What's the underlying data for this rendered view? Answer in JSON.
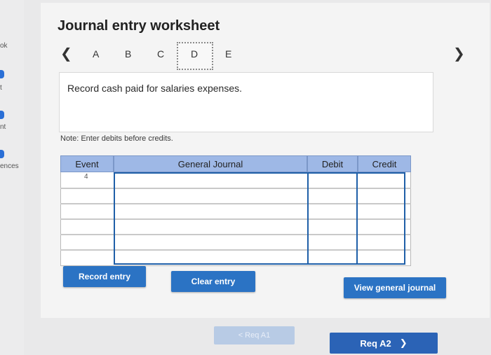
{
  "sidebar": {
    "items": [
      {
        "label": "ok"
      },
      {
        "label": "t"
      },
      {
        "label": "nt"
      },
      {
        "label": "ences"
      }
    ]
  },
  "worksheet": {
    "title": "Journal entry worksheet",
    "tabs": [
      "A",
      "B",
      "C",
      "D",
      "E"
    ],
    "active_tab": "D",
    "instruction": "Record cash paid for salaries expenses.",
    "note": "Note: Enter debits before credits."
  },
  "table": {
    "headers": {
      "event": "Event",
      "general_journal": "General Journal",
      "debit": "Debit",
      "credit": "Credit"
    },
    "rows": [
      {
        "event": "4",
        "account": "",
        "debit": "",
        "credit": ""
      },
      {
        "event": "",
        "account": "",
        "debit": "",
        "credit": ""
      },
      {
        "event": "",
        "account": "",
        "debit": "",
        "credit": ""
      },
      {
        "event": "",
        "account": "",
        "debit": "",
        "credit": ""
      },
      {
        "event": "",
        "account": "",
        "debit": "",
        "credit": ""
      },
      {
        "event": "",
        "account": "",
        "debit": "",
        "credit": ""
      }
    ]
  },
  "buttons": {
    "record_entry": "Record entry",
    "clear_entry": "Clear entry",
    "view_general_journal": "View general journal",
    "prev_req": "< Req A1",
    "next_req": "Req A2"
  },
  "colors": {
    "header_blue": "#9eb8e6",
    "button_blue": "#2b73c4",
    "selected_cell_border": "#1f5fa8"
  }
}
